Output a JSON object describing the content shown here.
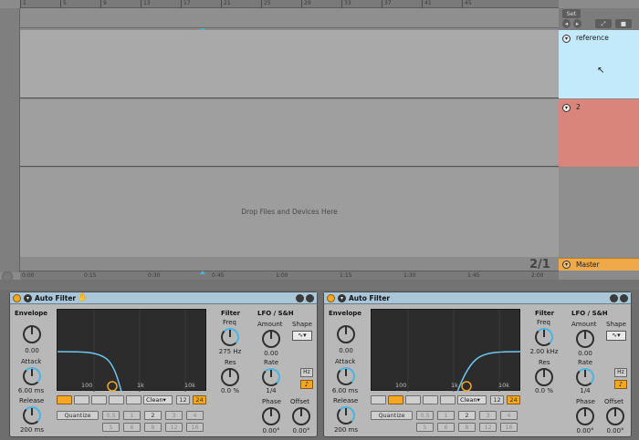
{
  "arrangement": {
    "ruler_top_ticks": [
      "1",
      "5",
      "9",
      "13",
      "17",
      "21",
      "25",
      "29",
      "33",
      "37",
      "41",
      "45"
    ],
    "ruler_bottom_ticks": [
      "0:00",
      "0:15",
      "0:30",
      "0:45",
      "1:00",
      "1:15",
      "1:30",
      "1:45",
      "2:00"
    ],
    "drop_text": "Drop Files and Devices Here",
    "set_label": "Set",
    "page_indicator": "2/1"
  },
  "tracks": [
    {
      "name": "reference",
      "color": "#c3eafb"
    },
    {
      "name": "2",
      "color": "#d9857c"
    }
  ],
  "master": {
    "name": "Master",
    "color": "#f0a94a"
  },
  "devices": [
    {
      "name": "Auto Filter",
      "envelope": {
        "label": "Envelope",
        "amount": "0.00",
        "attack_label": "Attack",
        "attack": "6.00 ms",
        "release_label": "Release",
        "release": "200 ms"
      },
      "graph_labels": [
        "100",
        "1k",
        "10k"
      ],
      "filter": {
        "label": "Filter",
        "freq_label": "Freq",
        "freq": "275 Hz",
        "res_label": "Res",
        "res": "0.0 %"
      },
      "lfo": {
        "label": "LFO / S&H",
        "amount_label": "Amount",
        "amount": "0.00",
        "shape_label": "Shape",
        "rate_label": "Rate",
        "rate": "1/4",
        "hz_label": "Hz",
        "phase_label": "Phase",
        "phase": "0.00°",
        "offset_label": "Offset",
        "offset": "0.00°"
      },
      "circuit": "Clean",
      "slopes": [
        "12",
        "24"
      ],
      "quantize_label": "Quantize",
      "quantize_values": [
        "0.5",
        "1",
        "2",
        "3",
        "4",
        "5",
        "6",
        "8",
        "12",
        "16"
      ]
    },
    {
      "name": "Auto Filter",
      "envelope": {
        "label": "Envelope",
        "amount": "0.00",
        "attack_label": "Attack",
        "attack": "6.00 ms",
        "release_label": "Release",
        "release": "200 ms"
      },
      "graph_labels": [
        "100",
        "1k",
        "10k"
      ],
      "filter": {
        "label": "Filter",
        "freq_label": "Freq",
        "freq": "2.00 kHz",
        "res_label": "Res",
        "res": "0.0 %"
      },
      "lfo": {
        "label": "LFO / S&H",
        "amount_label": "Amount",
        "amount": "0.00",
        "shape_label": "Shape",
        "rate_label": "Rate",
        "rate": "1/4",
        "hz_label": "Hz",
        "phase_label": "Phase",
        "phase": "0.00°",
        "offset_label": "Offset",
        "offset": "0.00°"
      },
      "circuit": "Clean",
      "slopes": [
        "12",
        "24"
      ],
      "quantize_label": "Quantize",
      "quantize_values": [
        "0.5",
        "1",
        "2",
        "3",
        "4",
        "5",
        "6",
        "8",
        "12",
        "16"
      ]
    }
  ],
  "icons": {
    "fold": "▾",
    "hand": "✋",
    "cursor": "➤",
    "select_arrow": "▾",
    "note": "♪",
    "sine": "∿"
  }
}
